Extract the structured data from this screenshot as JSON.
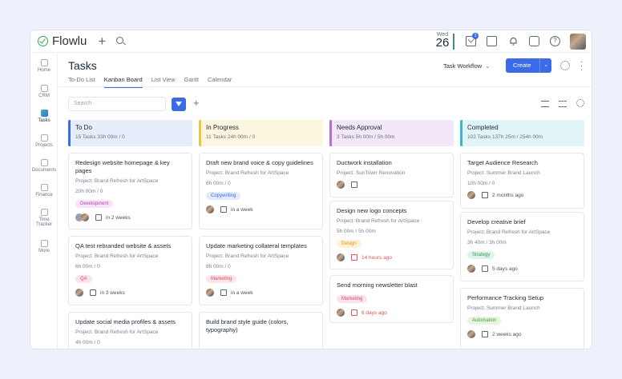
{
  "app": {
    "name": "Flowlu"
  },
  "topbar": {
    "date_dow": "Wed",
    "date_day": "26",
    "mail_badge": "3"
  },
  "sidebar": {
    "items": [
      {
        "label": "Home"
      },
      {
        "label": "CRM"
      },
      {
        "label": "Tasks"
      },
      {
        "label": "Projects"
      },
      {
        "label": "Documents"
      },
      {
        "label": "Finance"
      },
      {
        "label": "Time Tracker"
      },
      {
        "label": "More"
      }
    ]
  },
  "page": {
    "title": "Tasks",
    "tabs": [
      {
        "label": "To-Do List"
      },
      {
        "label": "Kanban Board"
      },
      {
        "label": "List View"
      },
      {
        "label": "Gantt"
      },
      {
        "label": "Calendar"
      }
    ],
    "workflow_label": "Task Workflow",
    "create_label": "Create",
    "search_placeholder": "Search"
  },
  "colors": {
    "accent": "#3b6be8",
    "todo": "#3b6be8",
    "in_progress": "#e8c640",
    "needs_approval": "#b36fd6",
    "completed": "#3fb5c9"
  },
  "columns": [
    {
      "title": "To Do",
      "meta": "15 Tasks   33h 00m / 0",
      "cards": [
        {
          "title": "Redesign website homepage & key pages",
          "project": "Project: Brand Refresh for ArtSpace",
          "time": "20h 00m / 0",
          "tag": "Development",
          "due": "in 2 weeks"
        },
        {
          "title": "QA test rebranded website & assets",
          "project": "Project: Brand Refresh for ArtSpace",
          "time": "6h 00m / 0",
          "tag": "QA",
          "due": "in 3 weeks"
        },
        {
          "title": "Update social media profiles & assets",
          "project": "Project: Brand Refresh for ArtSpace",
          "time": "4h 00m / 0"
        }
      ]
    },
    {
      "title": "In Progress",
      "meta": "11 Tasks   24h 00m / 0",
      "cards": [
        {
          "title": "Draft new brand voice & copy guidelines",
          "project": "Project: Brand Refresh for ArtSpace",
          "time": "6h 00m / 0",
          "tag": "Copywriting",
          "due": "in a week"
        },
        {
          "title": "Update marketing collateral templates",
          "project": "Project: Brand Refresh for ArtSpace",
          "time": "8h 00m / 0",
          "tag": "Marketing",
          "due": "in a week"
        },
        {
          "title": "Build brand style guide (colors, typography)",
          "project": "",
          "time": ""
        }
      ]
    },
    {
      "title": "Needs Approval",
      "meta": "3 Tasks   5h 00m / 5h 00m",
      "cards": [
        {
          "title": "Ductwork installation",
          "project": "Project: SunTown Renovation",
          "time": "",
          "due": ""
        },
        {
          "title": "Design new logo concepts",
          "project": "Project: Brand Refresh for ArtSpace",
          "time": "5h 00m / 5h 00m",
          "tag": "Design",
          "due": "14 hours ago"
        },
        {
          "title": "Send morning newsletter blast",
          "project": "",
          "time": "",
          "tag": "Marketing",
          "due": "6 days ago"
        }
      ]
    },
    {
      "title": "Completed",
      "meta": "102 Tasks   137h 25m / 254h 00m",
      "cards": [
        {
          "title": "Target Audience Research",
          "project": "Project: Summer Brand Launch",
          "time": "10h 00m / 0",
          "due": "2 months ago"
        },
        {
          "title": "Develop creative brief",
          "project": "Project: Brand Refresh for ArtSpace",
          "time": "3h 40m / 3h 00m",
          "tag": "Strategy",
          "due": "5 days ago"
        },
        {
          "title": "Performance Tracking Setup",
          "project": "Project: Summer Brand Launch",
          "time": "",
          "tag": "Automation",
          "due": "2 weeks ago"
        }
      ]
    }
  ]
}
